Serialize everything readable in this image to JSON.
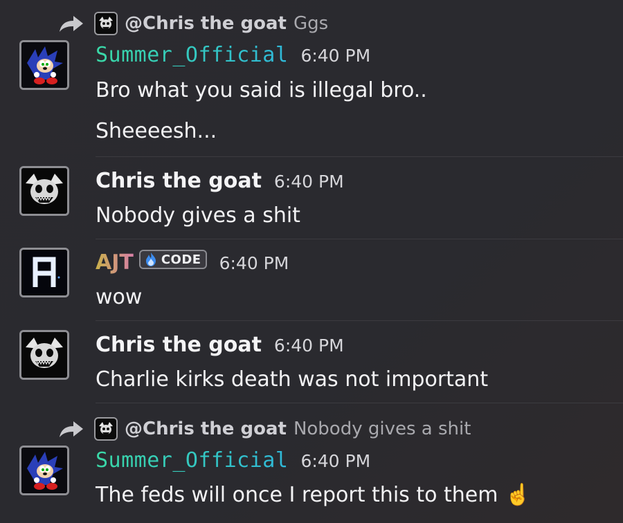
{
  "messages": [
    {
      "reply": {
        "mention": "@Chris the goat",
        "text": "Ggs"
      },
      "author": "Summer_Official",
      "time": "6:40 PM",
      "lines": [
        "Bro what you said is illegal bro..",
        "Sheeeesh..."
      ]
    },
    {
      "author": "Chris the goat",
      "time": "6:40 PM",
      "lines": [
        "Nobody gives a shit"
      ]
    },
    {
      "author": "AJT",
      "tag": {
        "icon": "blue-flame-icon",
        "label": "CODE"
      },
      "time": "6:40 PM",
      "lines": [
        "wow"
      ]
    },
    {
      "author": "Chris the goat",
      "time": "6:40 PM",
      "lines": [
        "Charlie kirks death was not important"
      ]
    },
    {
      "reply": {
        "mention": "@Chris the goat",
        "text": "Nobody gives a shit"
      },
      "author": "Summer_Official",
      "time": "6:40 PM",
      "lines": [
        "The feds will once I report this to them"
      ],
      "emoji": "☝️"
    }
  ],
  "colors": {
    "background": "#2b2a2f",
    "summer_gradient": [
      "#3ad8a6",
      "#2fb8d9"
    ],
    "ajt_gradient": [
      "#c9b04a",
      "#d77fa7"
    ],
    "timestamp": "#d6d6da",
    "reply_text": "#a9a9ae"
  }
}
